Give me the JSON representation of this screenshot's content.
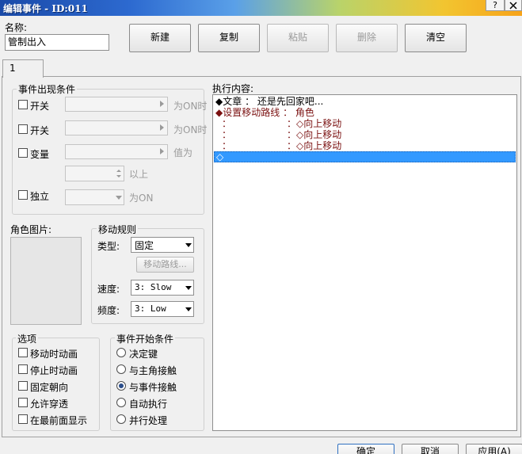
{
  "window": {
    "title": "编辑事件 - ID:011",
    "help_label": "?"
  },
  "name_field": {
    "label": "名称:",
    "value": "管制出入"
  },
  "toolbar": {
    "new_label": "新建",
    "copy_label": "复制",
    "paste_label": "粘贴",
    "delete_label": "删除",
    "clear_label": "清空"
  },
  "tab": {
    "label": "1"
  },
  "conditions": {
    "title": "事件出现条件",
    "switch1": {
      "label": "开关",
      "suffix": "为ON时"
    },
    "switch2": {
      "label": "开关",
      "suffix": "为ON时"
    },
    "variable": {
      "label": "变量",
      "suffix": "值为",
      "suffix2": "以上"
    },
    "self_switch": {
      "label": "独立",
      "suffix": "为ON"
    }
  },
  "character_image": {
    "label": "角色图片:"
  },
  "move_rules": {
    "title": "移动规则",
    "type_label": "类型:",
    "type_value": "固定",
    "route_button": "移动路线...",
    "speed_label": "速度:",
    "speed_value": "3: Slow",
    "freq_label": "频度:",
    "freq_value": "3: Low"
  },
  "options": {
    "title": "选项",
    "items": [
      "移动时动画",
      "停止时动画",
      "固定朝向",
      "允许穿透",
      "在最前面显示"
    ]
  },
  "trigger": {
    "title": "事件开始条件",
    "items": [
      "决定键",
      "与主角接触",
      "与事件接触",
      "自动执行",
      "并行处理"
    ],
    "selected_index": 2
  },
  "commands": {
    "label": "执行内容:",
    "line1_head": "◆文章",
    "line1_sep": "：",
    "line1_text": "还是先回家吧...",
    "line2_head": "◆设置移动路线",
    "line2_sep": "：",
    "line2_text": "角色",
    "sub_sep": "：",
    "sub_dot": "：",
    "sub_move": "◇向上移动",
    "empty_marker": "◇"
  },
  "footer": {
    "ok_label": "确定",
    "cancel_label": "取消",
    "apply_label": "应用(A)"
  }
}
